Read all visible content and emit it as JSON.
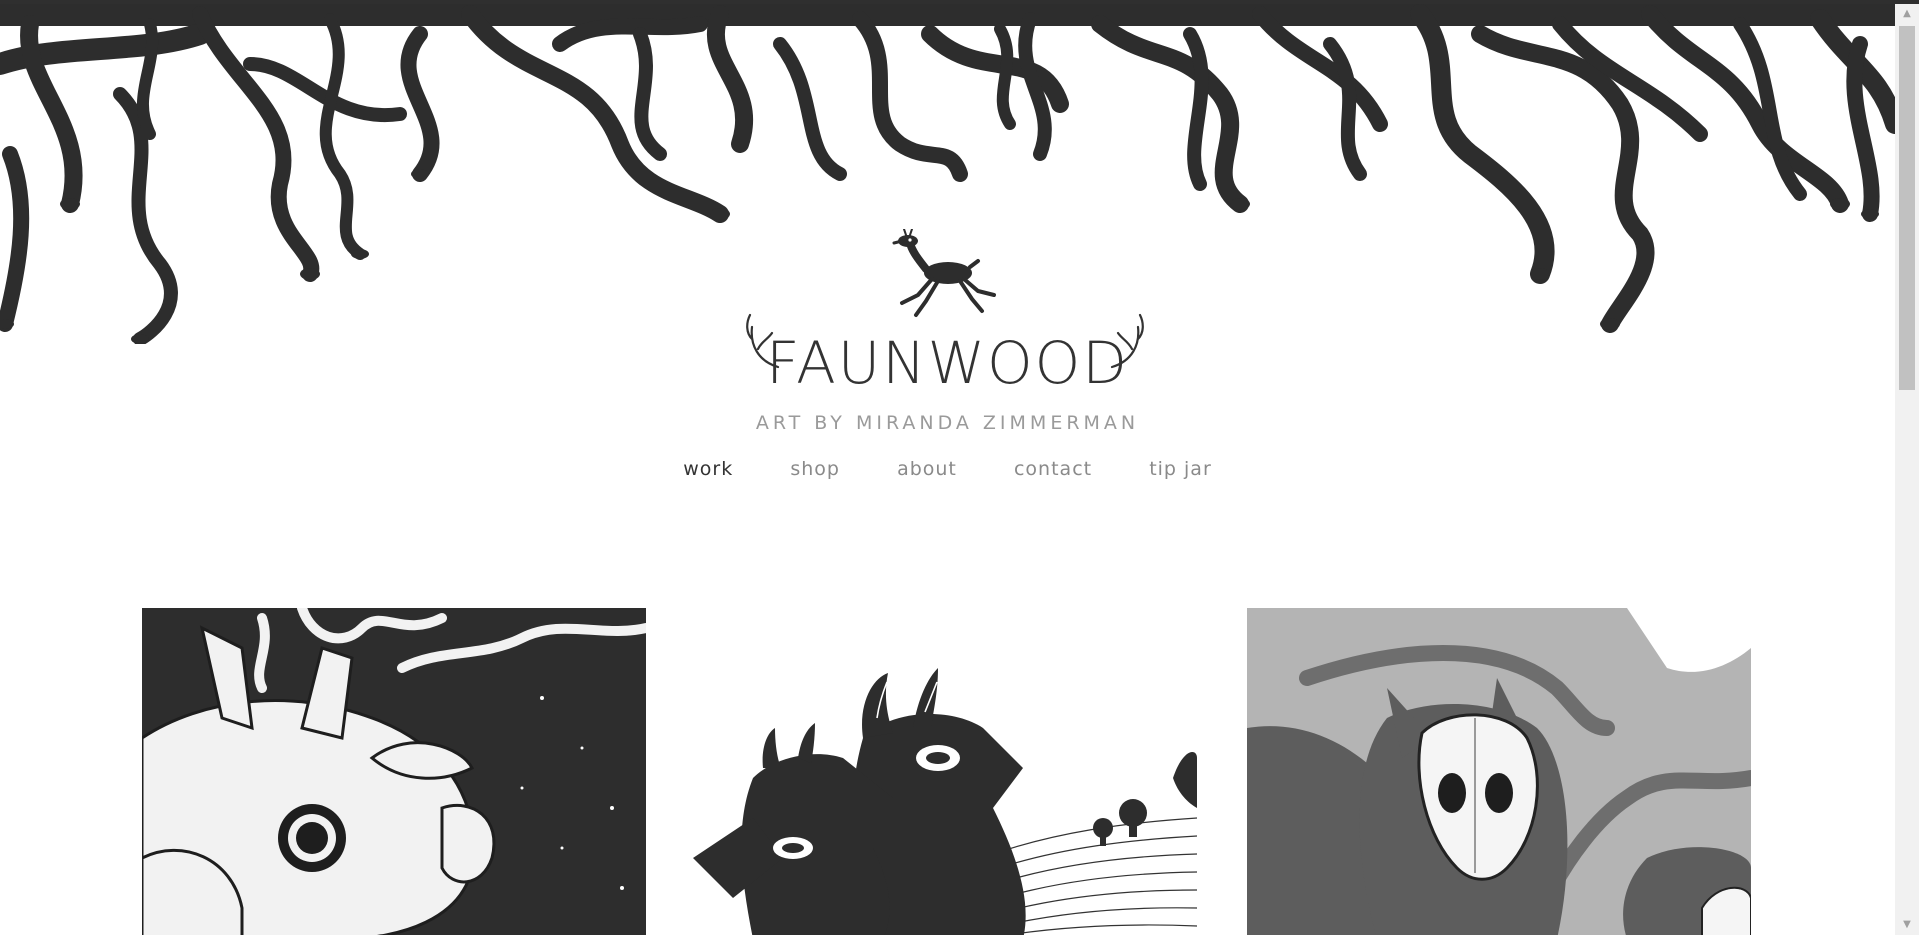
{
  "brand": {
    "name": "FAUNWOOD",
    "tagline": "ART BY MIRANDA ZIMMERMAN"
  },
  "nav": {
    "items": [
      {
        "label": "work",
        "active": true
      },
      {
        "label": "shop",
        "active": false
      },
      {
        "label": "about",
        "active": false
      },
      {
        "label": "contact",
        "active": false
      },
      {
        "label": "tip jar",
        "active": false
      }
    ]
  },
  "gallery": {
    "items": [
      {
        "name": "antlered-creature-artwork"
      },
      {
        "name": "two-black-deer-artwork"
      },
      {
        "name": "masked-creature-artwork"
      }
    ]
  },
  "icons": {
    "scroll_up": "▲",
    "scroll_down": "▼"
  },
  "colors": {
    "ink": "#333333",
    "nav_inactive": "#8a8a8a",
    "tagline": "#9a9a9a"
  }
}
